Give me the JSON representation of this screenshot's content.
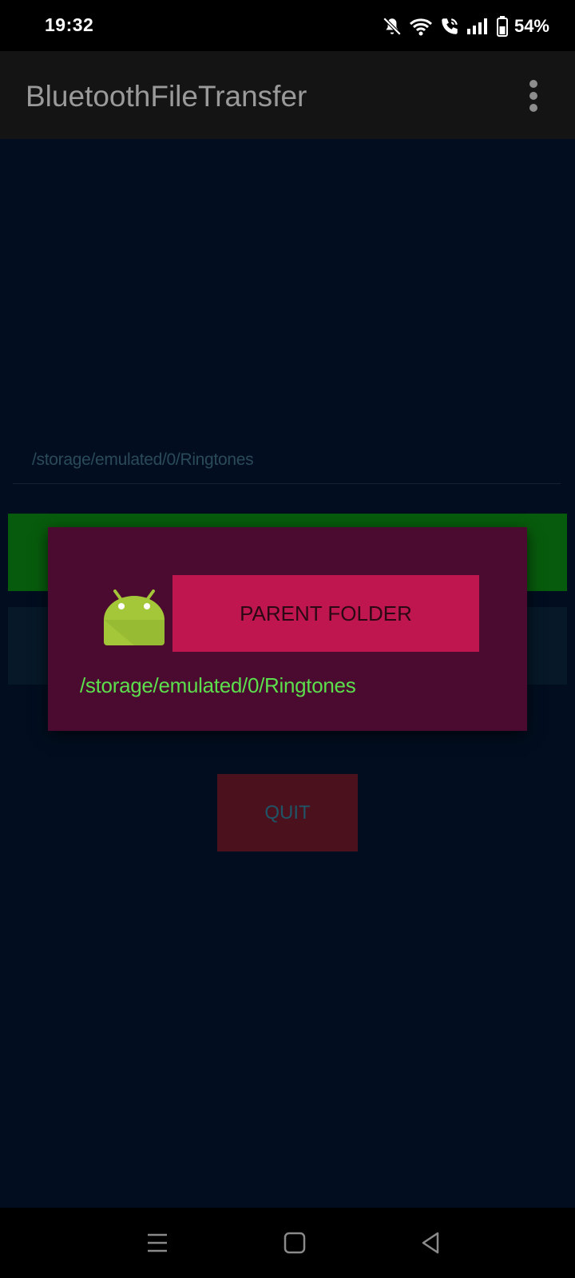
{
  "status_bar": {
    "time": "19:32",
    "battery_percent": "54%",
    "icons": [
      "mute-bell-icon",
      "wifi-icon",
      "wifi-call-icon",
      "signal-icon",
      "battery-icon"
    ]
  },
  "app_bar": {
    "title": "BluetoothFileTransfer",
    "menu_icon": "overflow-menu-icon"
  },
  "main": {
    "path_field_value": "/storage/emulated/0/Ringtones",
    "quit_label": "QUIT",
    "colors": {
      "background": "#020e1f",
      "green_button": "#075b0c",
      "quit_button": "#4b111d"
    }
  },
  "dialog": {
    "icon": "android-icon",
    "parent_folder_label": "PARENT FOLDER",
    "current_path": "/storage/emulated/0/Ringtones",
    "colors": {
      "background": "#4b0a30",
      "button": "#c01650",
      "path_text": "#5cdf4c"
    }
  },
  "nav_bar": {
    "buttons": [
      "recent-apps-icon",
      "home-icon",
      "back-icon"
    ]
  }
}
